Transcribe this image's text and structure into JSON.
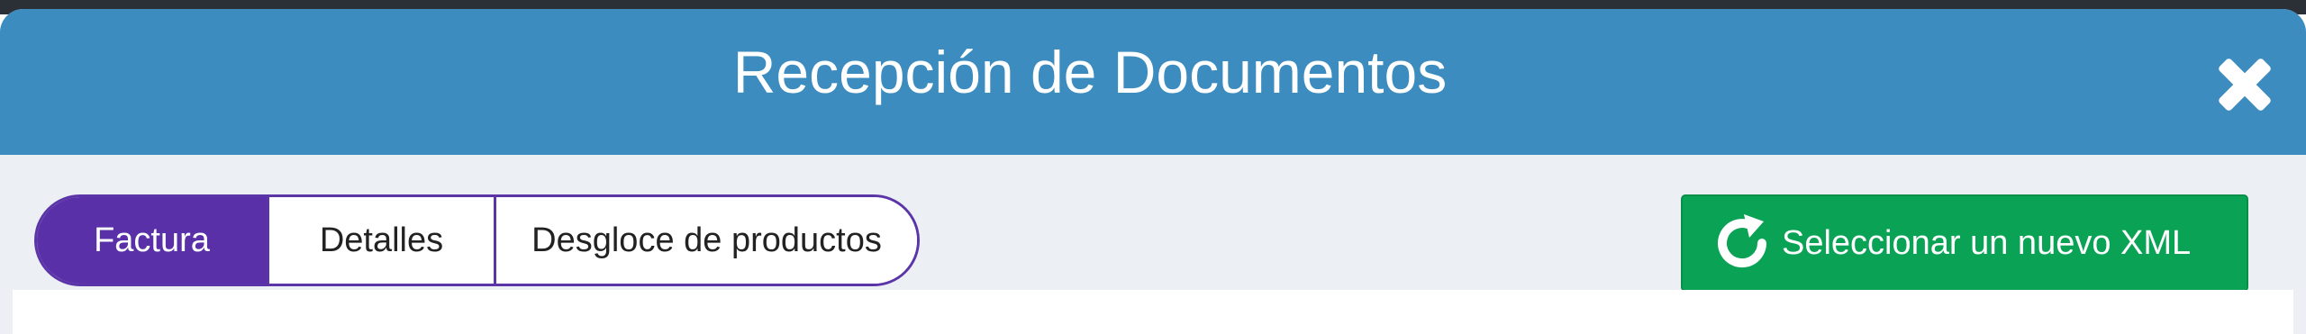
{
  "modal": {
    "title": "Recepción de Documentos",
    "close_icon": "close-icon"
  },
  "tabs": [
    {
      "label": "Factura",
      "active": true
    },
    {
      "label": "Detalles",
      "active": false
    },
    {
      "label": "Desgloce de productos",
      "active": false
    }
  ],
  "toolbar": {
    "reload_label": "Seleccionar un nuevo XML",
    "reload_icon": "refresh-icon"
  },
  "colors": {
    "header": "#3d8cbf",
    "active_tab": "#5a30a8",
    "action_button": "#0aa355",
    "background": "#eceff4"
  }
}
